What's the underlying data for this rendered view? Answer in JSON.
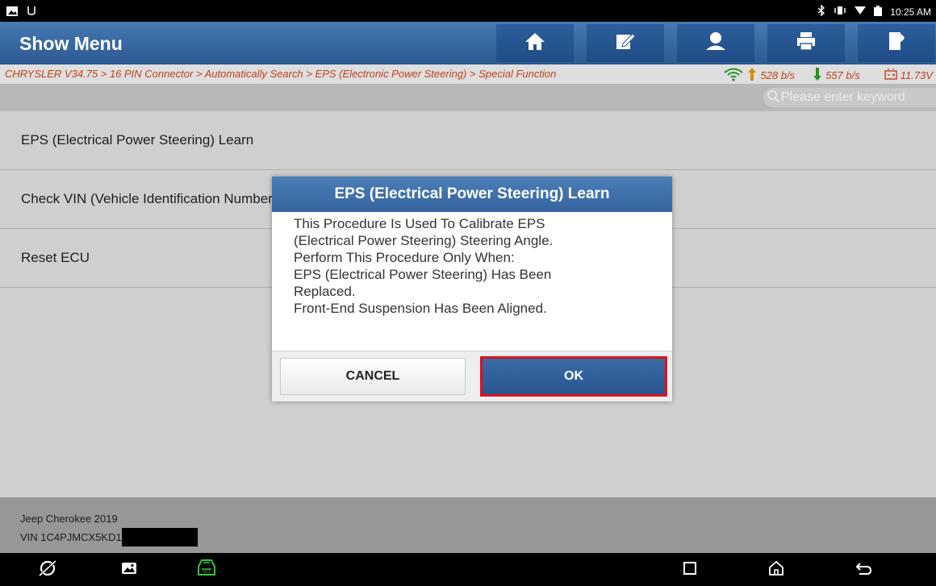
{
  "status_bar": {
    "time": "10:25 AM"
  },
  "header": {
    "title": "Show Menu",
    "buttons": [
      "home-icon",
      "edit-icon",
      "user-icon",
      "print-icon",
      "exit-icon"
    ]
  },
  "breadcrumb": {
    "path": "CHRYSLER V34.75 > 16 PIN Connector > Automatically Search > EPS (Electronic Power Steering) > Special Function",
    "upload": "528 b/s",
    "download": "557 b/s",
    "voltage": "11.73V"
  },
  "search": {
    "placeholder": "Please enter keyword"
  },
  "menu_items": [
    {
      "label": "EPS (Electrical Power Steering) Learn"
    },
    {
      "label": "Check VIN (Vehicle Identification Number)"
    },
    {
      "label": "Reset ECU"
    }
  ],
  "vehicle": {
    "model": "Jeep Cherokee 2019",
    "vin": "VIN 1C4PJMCX5KD1"
  },
  "dialog": {
    "title": "EPS (Electrical Power Steering) Learn",
    "lines": [
      "This Procedure Is Used To Calibrate EPS",
      "(Electrical Power Steering) Steering Angle.",
      "Perform This Procedure Only When:",
      "EPS (Electrical Power Steering) Has Been",
      "Replaced.",
      "Front-End Suspension Has Been Aligned."
    ],
    "cancel_label": "CANCEL",
    "ok_label": "OK"
  },
  "colors": {
    "header_blue": "#3a6aa3",
    "breadcrumb_text": "#d24a1c",
    "upload_arrow": "#e89b00",
    "download_arrow": "#2e9b2e",
    "ok_highlight": "#e0101a"
  }
}
